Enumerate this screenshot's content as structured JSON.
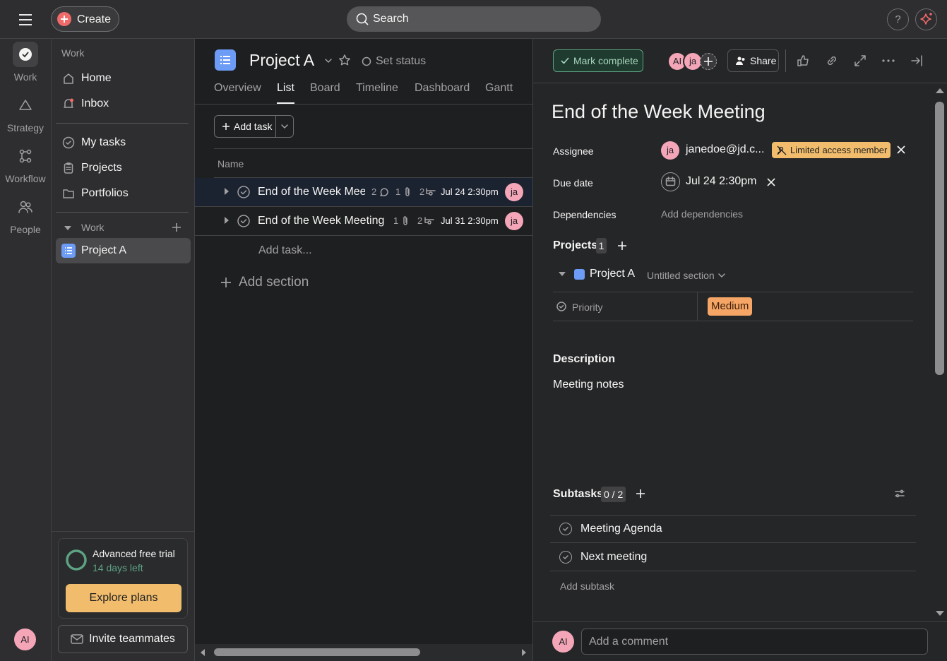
{
  "topbar": {
    "create_label": "Create",
    "search_placeholder": "Search",
    "help_label": "?"
  },
  "rail": {
    "items": [
      {
        "label": "Work",
        "icon": "check-circle-icon"
      },
      {
        "label": "Strategy",
        "icon": "triangle-icon"
      },
      {
        "label": "Workflow",
        "icon": "workflow-icon"
      },
      {
        "label": "People",
        "icon": "people-icon"
      }
    ],
    "avatar": "AI"
  },
  "sidebar": {
    "section_title": "Work",
    "items": [
      {
        "label": "Home",
        "icon": "home-icon"
      },
      {
        "label": "Inbox",
        "icon": "bell-icon"
      },
      {
        "label": "My tasks",
        "icon": "check-circle-icon"
      },
      {
        "label": "Projects",
        "icon": "clipboard-icon"
      },
      {
        "label": "Portfolios",
        "icon": "folder-icon"
      }
    ],
    "group_title": "Work",
    "project_label": "Project A",
    "trial_title": "Advanced free trial",
    "trial_sub": "14 days left",
    "explore_label": "Explore plans",
    "invite_label": "Invite teammates"
  },
  "project": {
    "title": "Project A",
    "set_status": "Set status",
    "tabs": [
      "Overview",
      "List",
      "Board",
      "Timeline",
      "Dashboard",
      "Gantt"
    ],
    "active_tab": "List",
    "add_task_label": "Add task",
    "column_name": "Name",
    "tasks": [
      {
        "name": "End of the Week Mee",
        "comments": "2",
        "attachments": "1",
        "subtasks": "2",
        "due": "Jul 24 2:30pm",
        "assignee": "ja"
      },
      {
        "name": "End of the Week Meeting",
        "attachments": "1",
        "subtasks": "2",
        "due": "Jul 31 2:30pm",
        "assignee": "ja"
      }
    ],
    "add_task_inline": "Add task...",
    "add_section": "Add section"
  },
  "detail": {
    "mark_complete": "Mark complete",
    "collaborators": [
      "AI",
      "ja"
    ],
    "share_label": "Share",
    "title": "End of the Week Meeting",
    "assignee_label": "Assignee",
    "assignee_avatar": "ja",
    "assignee_value": "janedoe@jd.c...",
    "limited_access": "Limited access member",
    "due_label": "Due date",
    "due_value": "Jul 24 2:30pm",
    "dependencies_label": "Dependencies",
    "add_dependencies": "Add dependencies",
    "projects_label": "Projects",
    "projects_count": "1",
    "project_name": "Project A",
    "section_name": "Untitled section",
    "priority_label": "Priority",
    "priority_value": "Medium",
    "description_label": "Description",
    "description_value": "Meeting notes",
    "subtasks_label": "Subtasks",
    "subtasks_count": "0 / 2",
    "subtasks": [
      "Meeting Agenda",
      "Next meeting"
    ],
    "add_subtask": "Add subtask",
    "comment_avatar": "AI",
    "comment_placeholder": "Add a comment"
  },
  "colors": {
    "accent_red": "#f06a6a",
    "project_blue": "#6c9cf5",
    "priority_orange": "#f5a565",
    "warning_badge": "#f1bd6c",
    "complete_green": "#5da283"
  }
}
